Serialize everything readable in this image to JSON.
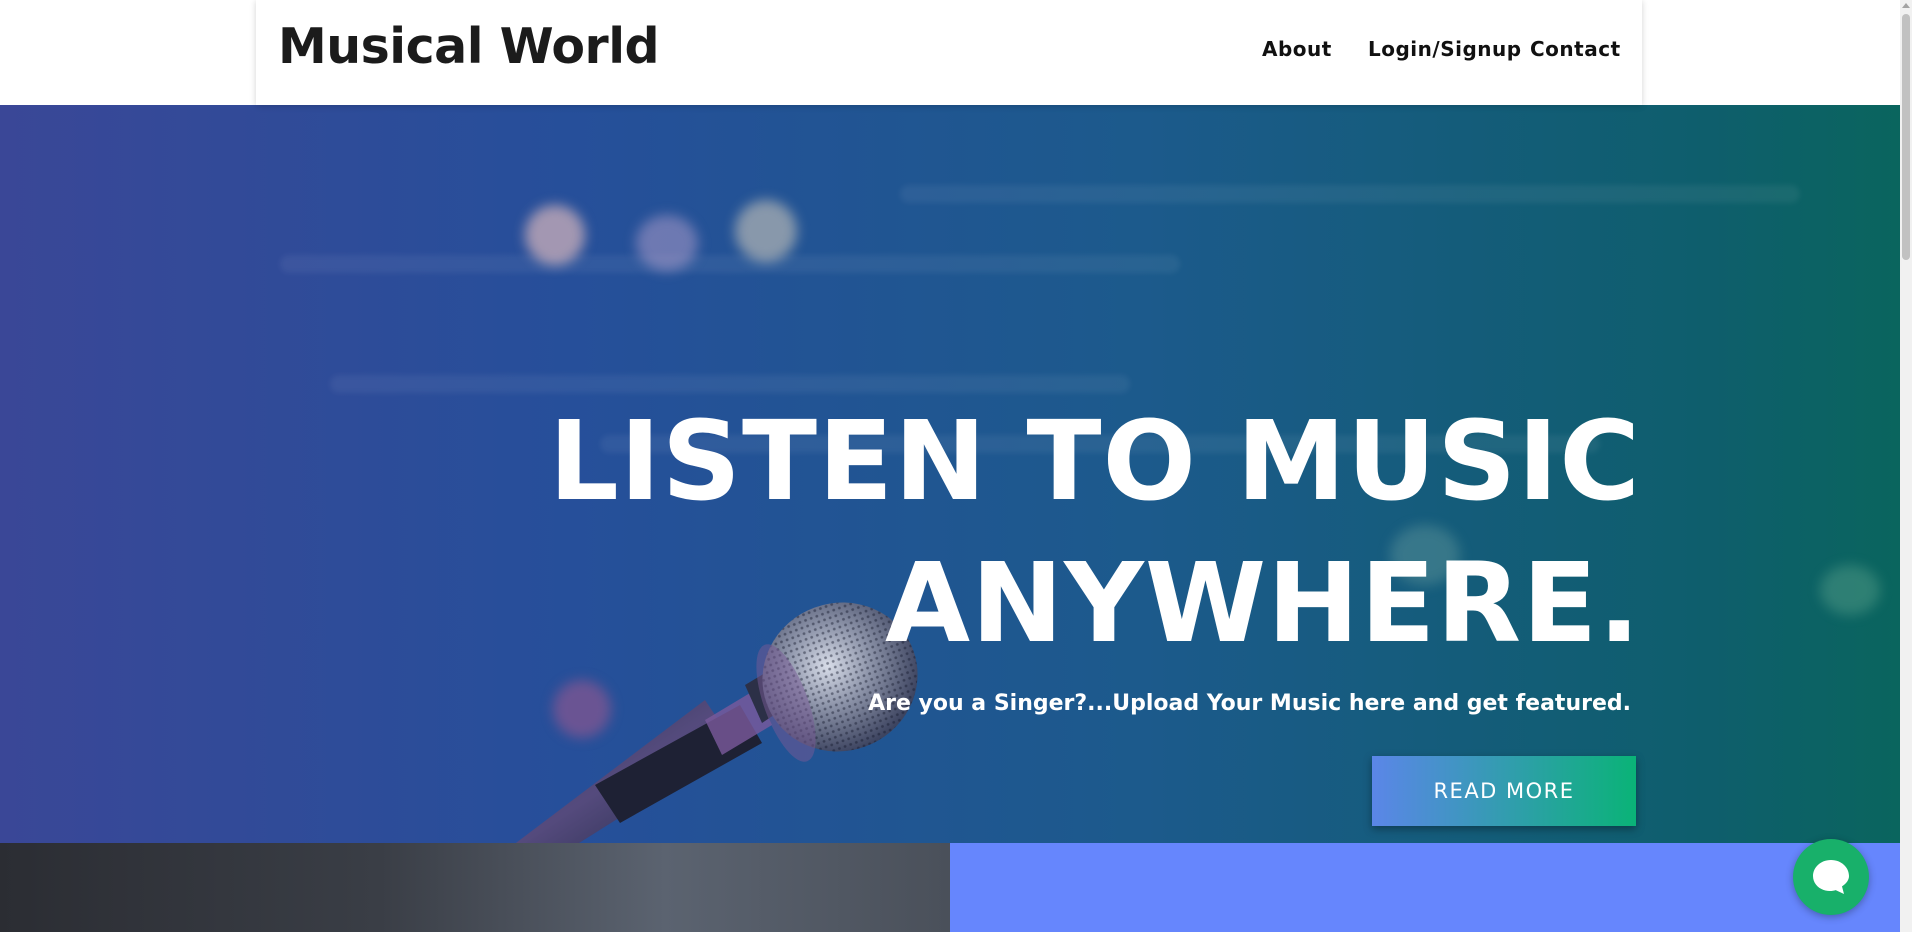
{
  "header": {
    "brand": "Musical World",
    "nav": [
      {
        "label": "About"
      },
      {
        "label": "Login/Signup"
      },
      {
        "label": "Contact"
      }
    ]
  },
  "hero": {
    "title_line1": "LISTEN TO MUSIC",
    "title_line2": "ANYWHERE.",
    "subtitle": "Are you a Singer?...Upload Your Music here and get featured.",
    "cta_label": "READ MORE",
    "image": "microphone-on-stage"
  },
  "colors": {
    "hero_gradient_start": "#3a4797",
    "hero_gradient_end": "#0a655e",
    "cta_gradient_start": "#5b86e8",
    "cta_gradient_end": "#0ab377",
    "section_blue": "#6686fd",
    "chat_green": "#18b06a"
  },
  "chat_widget": {
    "icon": "chat-bubble-icon"
  }
}
